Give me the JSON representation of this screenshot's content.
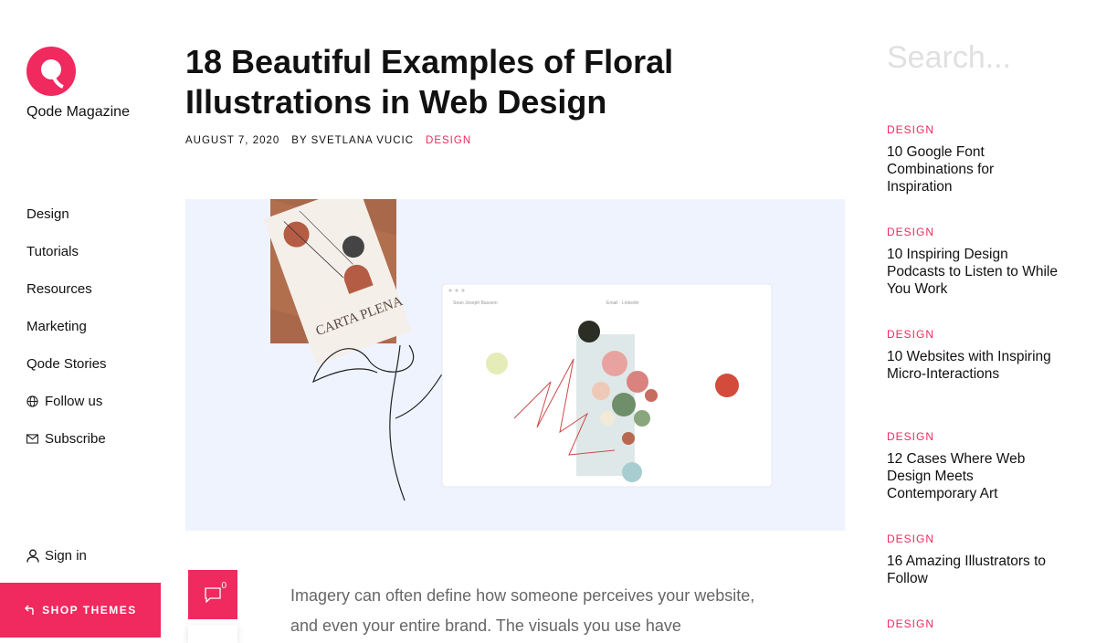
{
  "brand": {
    "name": "Qode Magazine",
    "accent": "#f0295f"
  },
  "nav": {
    "items": [
      {
        "label": "Design"
      },
      {
        "label": "Tutorials"
      },
      {
        "label": "Resources"
      },
      {
        "label": "Marketing"
      },
      {
        "label": "Qode Stories"
      },
      {
        "label": "Follow us",
        "icon": "globe-icon"
      },
      {
        "label": "Subscribe",
        "icon": "mail-icon"
      }
    ],
    "sign_in": "Sign in",
    "shop": "SHOP THEMES"
  },
  "article": {
    "title": "18 Beautiful Examples of Floral Illustrations in Web Design",
    "date": "AUGUST 7, 2020",
    "author": "BY SVETLANA VUCIC",
    "category": "DESIGN",
    "comment_count": "0",
    "intro": "Imagery can often define how someone perceives your website, and even your entire brand. The visuals you use have"
  },
  "hero": {
    "card_text": "CARTA PLENA",
    "window_left_text": "Sean Joseph Bassem",
    "window_right_text": "Email · Linkedin"
  },
  "search": {
    "placeholder": "Search..."
  },
  "sidebar_posts": [
    {
      "category": "DESIGN",
      "title": "10 Google Font Combinations for Inspiration"
    },
    {
      "category": "DESIGN",
      "title": "10 Inspiring Design Podcasts to Listen to While You Work"
    },
    {
      "category": "DESIGN",
      "title": "10 Websites with Inspiring Micro-Interactions"
    },
    {
      "category": "DESIGN",
      "title": "12 Cases Where Web Design Meets Contemporary Art"
    },
    {
      "category": "DESIGN",
      "title": "16 Amazing Illustrators to Follow"
    },
    {
      "category": "DESIGN",
      "title": ""
    }
  ]
}
